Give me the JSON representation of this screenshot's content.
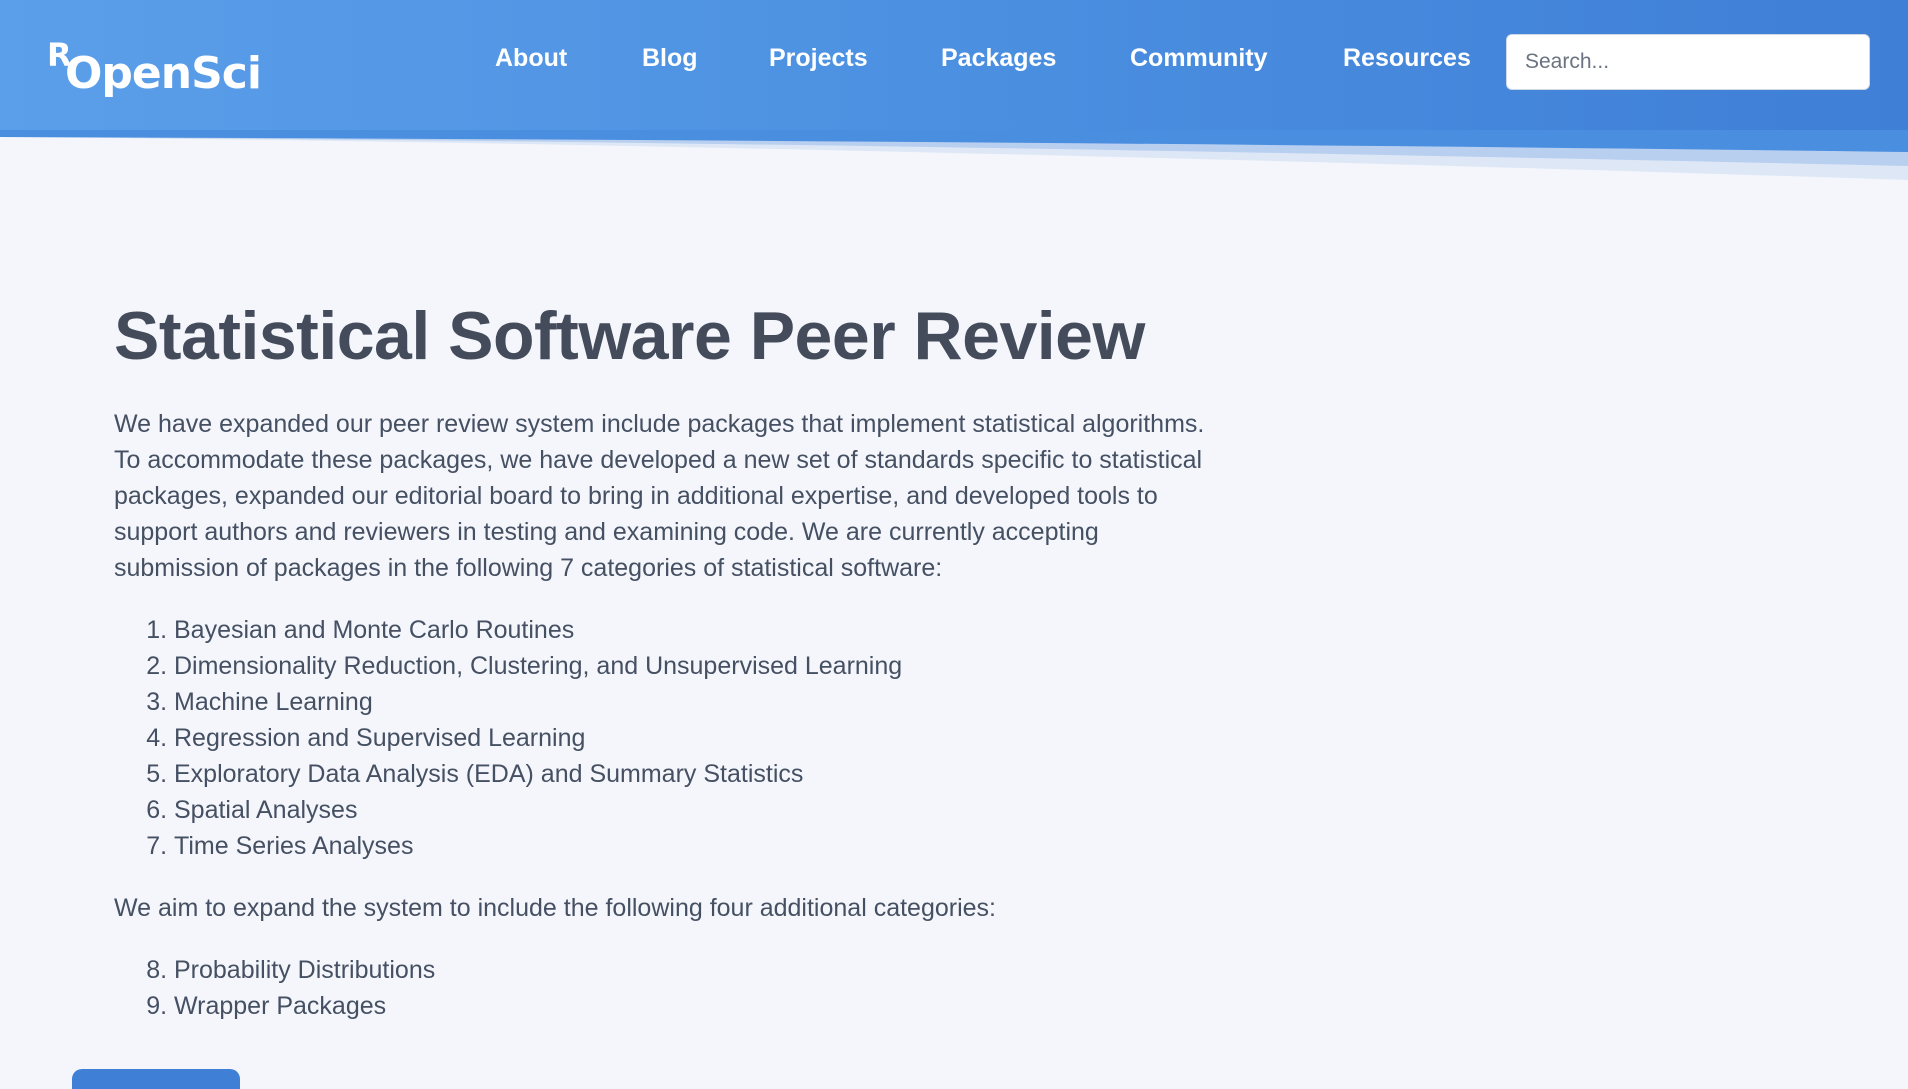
{
  "header": {
    "logo_r": "R",
    "logo_text": "OpenSci",
    "nav": [
      {
        "label": "About"
      },
      {
        "label": "Blog"
      },
      {
        "label": "Projects"
      },
      {
        "label": "Packages"
      },
      {
        "label": "Community"
      },
      {
        "label": "Resources"
      }
    ],
    "search_placeholder": "Search..."
  },
  "main": {
    "title": "Statistical Software Peer Review",
    "intro": "We have expanded our peer review system include packages that implement statistical algorithms. To accommodate these packages, we have developed a new set of standards specific to statistical packages, expanded our editorial board to bring in additional expertise, and developed tools to support authors and reviewers in testing and examining code. We are currently accepting submission of packages in the following 7 categories of statistical software:",
    "categories": [
      "Bayesian and Monte Carlo Routines",
      "Dimensionality Reduction, Clustering, and Unsupervised Learning",
      "Machine Learning",
      "Regression and Supervised Learning",
      "Exploratory Data Analysis (EDA) and Summary Statistics",
      "Spatial Analyses",
      "Time Series Analyses"
    ],
    "aim_text": "We aim to expand the system to include the following four additional categories:",
    "additional_categories": [
      "Probability Distributions",
      "Wrapper Packages"
    ]
  },
  "colors": {
    "header_start": "#5b9fea",
    "header_end": "#3f7fd6",
    "background": "#f4f6fb",
    "text": "#455063",
    "title": "#444c5c"
  }
}
